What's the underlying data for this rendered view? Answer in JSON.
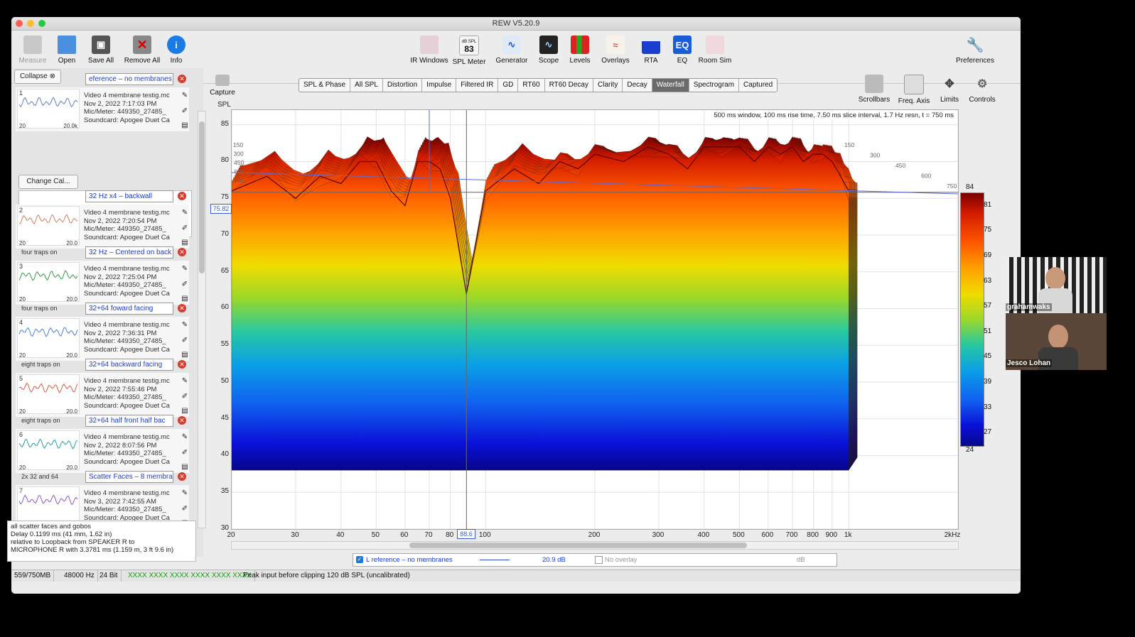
{
  "window": {
    "title": "REW V5.20.9"
  },
  "toolbar": {
    "left": [
      {
        "label": "Measure",
        "icon": "measure-icon",
        "enabled": false
      },
      {
        "label": "Open",
        "icon": "folder-icon",
        "enabled": true
      },
      {
        "label": "Save All",
        "icon": "save-icon",
        "enabled": true
      },
      {
        "label": "Remove All",
        "icon": "remove-icon",
        "enabled": true
      },
      {
        "label": "Info",
        "icon": "info-icon",
        "enabled": true
      }
    ],
    "center": [
      {
        "label": "IR Windows",
        "icon": "ir-windows-icon"
      },
      {
        "label": "SPL Meter",
        "icon": "spl-meter-icon",
        "badge": "83",
        "badge_unit": "dB SPL"
      },
      {
        "label": "Generator",
        "icon": "generator-icon"
      },
      {
        "label": "Scope",
        "icon": "scope-icon"
      },
      {
        "label": "Levels",
        "icon": "levels-icon"
      },
      {
        "label": "Overlays",
        "icon": "overlays-icon"
      },
      {
        "label": "RTA",
        "icon": "rta-icon"
      },
      {
        "label": "EQ",
        "icon": "eq-icon"
      },
      {
        "label": "Room Sim",
        "icon": "room-sim-icon"
      }
    ],
    "preferences": "Preferences"
  },
  "sidebar": {
    "collapse": "Collapse",
    "change_cal": "Change Cal...",
    "measurements": [
      {
        "num": "1",
        "name": "eference – no membranes",
        "lines": [
          "Video 4 membrane testig.mc",
          "Nov 2, 2022 7:17:03 PM",
          "Mic/Meter: 449350_27485_",
          "Soundcard: Apogee Duet Ca"
        ],
        "lo": "20",
        "hi": "20.0k"
      },
      {
        "num": "2",
        "name": "32 Hz x4 – backwall",
        "lines": [
          "Video 4 membrane testig.mc",
          "Nov 2, 2022 7:20:54 PM",
          "Mic/Meter: 449350_27485_",
          "Soundcard: Apogee Duet Ca"
        ],
        "lo": "20",
        "hi": "20.0",
        "gap": "four traps on"
      },
      {
        "num": "3",
        "name": "32 Hz – Centered on back",
        "lines": [
          "Video 4 membrane testig.mc",
          "Nov 2, 2022 7:25:04 PM",
          "Mic/Meter: 449350_27485_",
          "Soundcard: Apogee Duet Ca"
        ],
        "lo": "20",
        "hi": "20.0",
        "gap": "four traps on"
      },
      {
        "num": "4",
        "name": "32+64 foward facing",
        "lines": [
          "Video 4 membrane testig.mc",
          "Nov 2, 2022 7:36:31 PM",
          "Mic/Meter: 449350_27485_",
          "Soundcard: Apogee Duet Ca"
        ],
        "lo": "20",
        "hi": "20.0",
        "gap": "eight traps on"
      },
      {
        "num": "5",
        "name": "32+64 backward facing",
        "lines": [
          "Video 4 membrane testig.mc",
          "Nov 2, 2022 7:55:46 PM",
          "Mic/Meter: 449350_27485_",
          "Soundcard: Apogee Duet Ca"
        ],
        "lo": "20",
        "hi": "20.0",
        "gap": "eight traps on"
      },
      {
        "num": "6",
        "name": "32+64 half front half bac",
        "lines": [
          "Video 4 membrane testig.mc",
          "Nov 2, 2022 8:07:56 PM",
          "Mic/Meter: 449350_27485_",
          "Soundcard: Apogee Duet Ca"
        ],
        "lo": "20",
        "hi": "20.0",
        "gap": "2x 32 and 64"
      },
      {
        "num": "7",
        "name": "Scatter Faces – 8 membra",
        "lines": [
          "Video 4 membrane testig.mc",
          "Nov 3, 2022 7:42:55 AM",
          "Mic/Meter: 449350_27485_",
          "Soundcard: Apogee Duet Ca"
        ],
        "lo": "20",
        "hi": "20.0k"
      }
    ],
    "notes": [
      "all scatter faces and gobos",
      "Delay 0.1199 ms (41 mm, 1.62 in)",
      "  relative to Loopback from SPEAKER R to",
      "MICROPHONE R with 3.3781 ms (1.159 m, 3 ft 9.6 in)"
    ]
  },
  "graph": {
    "capture": "Capture",
    "tabs": [
      "SPL & Phase",
      "All SPL",
      "Distortion",
      "Impulse",
      "Filtered IR",
      "GD",
      "RT60",
      "RT60 Decay",
      "Clarity",
      "Decay",
      "Waterfall",
      "Spectrogram",
      "Captured"
    ],
    "active_tab": "Waterfall",
    "right_controls": [
      "Scrollbars",
      "Freq. Axis",
      "Limits",
      "Controls"
    ],
    "header": "500 ms window, 100 ms rise time, 7.50 ms slice interval, 1.7 Hz resn, t = 750 ms",
    "y_axis_label": "SPL",
    "y_ticks": [
      "85",
      "80",
      "75",
      "70",
      "65",
      "60",
      "55",
      "50",
      "45",
      "40",
      "35",
      "30"
    ],
    "x_ticks": [
      "20",
      "30",
      "40",
      "50",
      "60",
      "70",
      "80",
      "100",
      "200",
      "300",
      "400",
      "500",
      "600",
      "700",
      "800",
      "900",
      "1k",
      "2kHz"
    ],
    "cursor_x": "88.6",
    "cursor_y": "75.82",
    "time_ticks_left": [
      "150",
      "300",
      "450",
      "600",
      "750"
    ],
    "time_ticks_right": [
      "150",
      "300",
      "450",
      "600",
      "750"
    ],
    "colorbar_labels": [
      "84",
      "81",
      "75",
      "69",
      "63",
      "57",
      "51",
      "45",
      "39",
      "33",
      "27",
      "24"
    ],
    "legend": {
      "checked": true,
      "name": "L reference – no membranes",
      "value": "20.9 dB",
      "overlay": "No overlay",
      "overlay_unit": "dB"
    }
  },
  "chart_data": {
    "type": "waterfall",
    "xlabel": "",
    "ylabel": "SPL",
    "x_scale": "log",
    "xlim": [
      20,
      2000
    ],
    "ylim": [
      30,
      87
    ],
    "colorbar_range": [
      24,
      84
    ],
    "front_slice_freq": [
      20,
      25,
      30,
      35,
      40,
      45,
      50,
      55,
      60,
      65,
      70,
      75,
      80,
      88.6,
      100,
      120,
      140,
      160,
      180,
      200,
      240,
      280,
      320,
      360,
      400,
      450,
      500,
      550,
      600,
      650,
      700,
      750,
      800,
      850,
      900,
      950,
      1000
    ],
    "front_slice_spl": [
      76,
      78,
      75,
      78,
      77,
      80,
      80,
      76,
      74,
      80,
      80,
      79,
      75,
      62,
      76,
      79,
      77,
      80,
      79,
      81,
      80,
      82,
      81,
      79,
      82,
      82,
      82,
      80,
      82,
      81,
      82,
      80,
      81,
      81,
      80,
      78,
      76
    ]
  },
  "status": {
    "memory": "559/750MB",
    "rate": "48000 Hz",
    "bits": "24 Bit",
    "levels": "XXXX XXXX  XXXX XXXX  XXXX XXXX",
    "message": "Peak input before clipping 120 dB SPL (uncalibrated)"
  },
  "video": [
    {
      "name": "grahamwaks"
    },
    {
      "name": "Jesco Lohan"
    }
  ]
}
